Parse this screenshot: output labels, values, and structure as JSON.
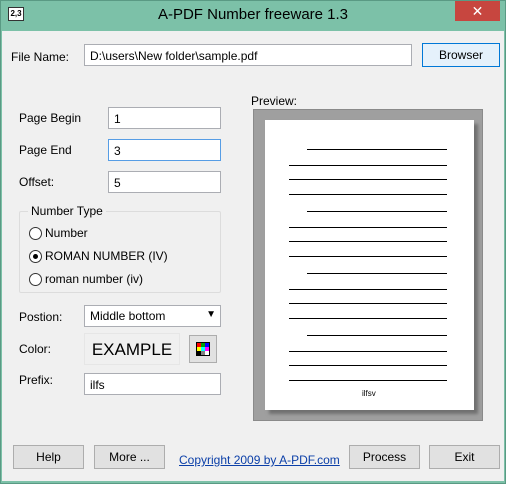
{
  "window": {
    "title": "A-PDF Number freeware 1.3",
    "close_glyph": "✕",
    "app_icon_text": "2,3"
  },
  "file": {
    "label": "File Name:",
    "value": "D:\\users\\New folder\\sample.pdf",
    "browse_label": "Browser"
  },
  "pages": {
    "begin_label": "Page Begin",
    "begin_value": "1",
    "end_label": "Page End",
    "end_value": "3",
    "offset_label": "Offset:",
    "offset_value": "5"
  },
  "number_type": {
    "title": "Number Type",
    "options": [
      {
        "label": "Number",
        "checked": false
      },
      {
        "label": "ROMAN NUMBER (IV)",
        "checked": true
      },
      {
        "label": "roman number (iv)",
        "checked": false
      }
    ]
  },
  "position": {
    "label": "Postion:",
    "value": "Middle bottom"
  },
  "color": {
    "label": "Color:",
    "example_text": "EXAMPLE",
    "palette_colors": [
      "#ff0000",
      "#00a000",
      "#0000ff",
      "#ffff00",
      "#00ffff",
      "#ff00ff",
      "#000000",
      "#808080",
      "#ffffff"
    ]
  },
  "prefix": {
    "label": "Prefix:",
    "value": "ilfs"
  },
  "preview": {
    "label": "Preview:",
    "page_label": "ilfsv"
  },
  "footer": {
    "help_label": "Help",
    "more_label": "More ...",
    "copyright": "Copyright 2009 by A-PDF.com",
    "process_label": "Process",
    "exit_label": "Exit"
  }
}
